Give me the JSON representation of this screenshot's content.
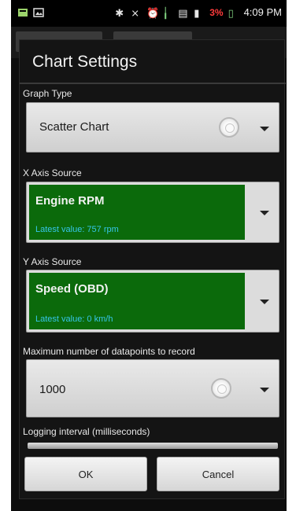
{
  "status_bar": {
    "time": "4:09 PM",
    "battery_percent": "3%",
    "icons": [
      "sd-card-icon",
      "image-icon",
      "bluetooth-icon",
      "silent-icon",
      "alarm-icon",
      "usb-icon",
      "data-icon",
      "signal-icon",
      "battery-icon"
    ]
  },
  "dialog": {
    "title": "Chart Settings",
    "graph_type": {
      "label": "Graph Type",
      "value": "Scatter Chart"
    },
    "x_axis": {
      "label": "X Axis Source",
      "value": "Engine RPM",
      "latest": "Latest value: 757 rpm"
    },
    "y_axis": {
      "label": "Y Axis Source",
      "value": "Speed (OBD)",
      "latest": "Latest value: 0 km/h"
    },
    "max_points": {
      "label": "Maximum number of datapoints to record",
      "value": "1000"
    },
    "logging_interval": {
      "label": "Logging interval (milliseconds)"
    },
    "buttons": {
      "ok": "OK",
      "cancel": "Cancel"
    }
  },
  "colors": {
    "green_panel": "#0b6a0b",
    "latest_value_text": "#36c6e8",
    "battery_text": "#ff3b3b"
  }
}
